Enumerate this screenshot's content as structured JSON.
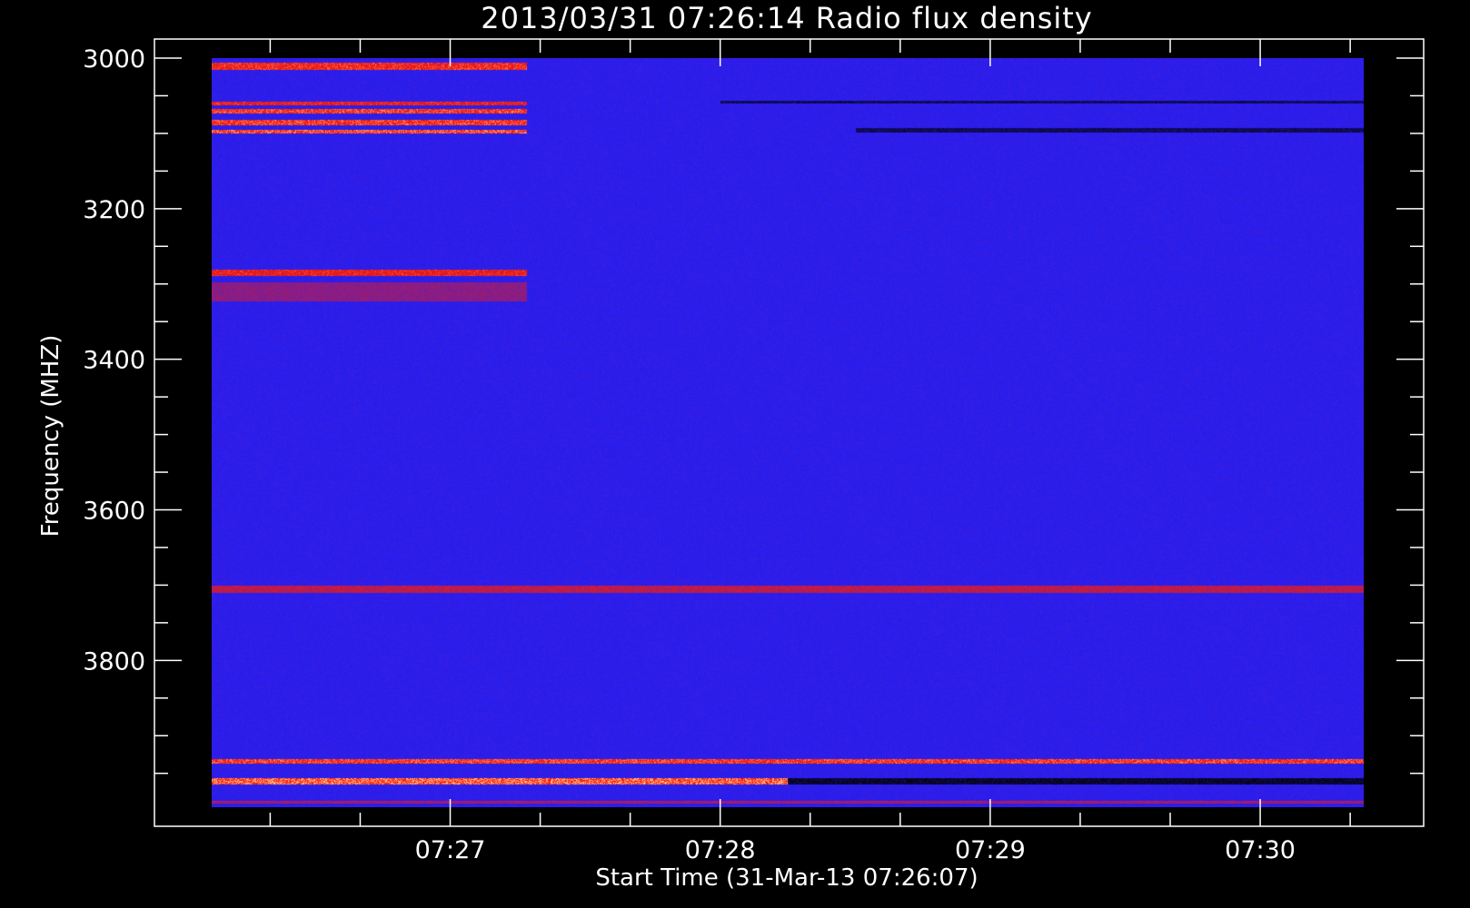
{
  "chart_data": {
    "type": "heatmap",
    "title": "2013/03/31 07:26:14 Radio flux density",
    "xlabel": "Start Time (31-Mar-13 07:26:07)",
    "ylabel": "Frequency (MHZ)",
    "x_tick_labels": [
      "07:27",
      "07:28",
      "07:29",
      "07:30"
    ],
    "y_tick_labels": [
      "3000",
      "3200",
      "3400",
      "3600",
      "3800"
    ],
    "y_ticks_mhz": [
      3000,
      3200,
      3400,
      3600,
      3800
    ],
    "y_range_mhz": [
      3000,
      3995
    ],
    "y_inverted": true,
    "x_ticks": [
      "07:27:00",
      "07:28:00",
      "07:29:00",
      "07:30:00"
    ],
    "x_minor_tick_seconds": 20,
    "y_minor_tick_mhz": 50,
    "x_range": [
      "07:26:07",
      "07:30:23"
    ],
    "colormap": [
      "#000000",
      "#1a10d8",
      "#2a1ef2",
      "#ff1a00",
      "#ffe0b0"
    ],
    "background_color": "#2a1ef2",
    "features": [
      {
        "label": "strong emission band",
        "freq_mhz": 3010,
        "width_mhz": 10,
        "start": "07:26:07",
        "end": "07:27:17",
        "intensity": 0.85
      },
      {
        "label": "strong emission band",
        "freq_mhz": 3060,
        "width_mhz": 5,
        "start": "07:26:07",
        "end": "07:27:17",
        "intensity": 0.8
      },
      {
        "label": "strong emission band",
        "freq_mhz": 3070,
        "width_mhz": 5,
        "start": "07:26:07",
        "end": "07:27:17",
        "intensity": 0.9
      },
      {
        "label": "strong emission band",
        "freq_mhz": 3085,
        "width_mhz": 8,
        "start": "07:26:07",
        "end": "07:27:17",
        "intensity": 0.9
      },
      {
        "label": "strong emission band",
        "freq_mhz": 3097,
        "width_mhz": 5,
        "start": "07:26:07",
        "end": "07:27:17",
        "intensity": 0.95
      },
      {
        "label": "emission band",
        "freq_mhz": 3285,
        "width_mhz": 8,
        "start": "07:26:07",
        "end": "07:27:17",
        "intensity": 0.8
      },
      {
        "label": "weak emission band",
        "freq_mhz": 3310,
        "width_mhz": 25,
        "start": "07:26:07",
        "end": "07:27:17",
        "intensity": 0.4
      },
      {
        "label": "interference band",
        "freq_mhz": 3705,
        "width_mhz": 10,
        "start": "07:26:07",
        "end": "07:30:23",
        "intensity": 0.6
      },
      {
        "label": "strong emission band",
        "freq_mhz": 3933,
        "width_mhz": 6,
        "start": "07:26:07",
        "end": "07:30:23",
        "intensity": 0.9
      },
      {
        "label": "strong emission band",
        "freq_mhz": 3960,
        "width_mhz": 8,
        "start": "07:26:07",
        "end": "07:28:15",
        "intensity": 1.0
      },
      {
        "label": "absorption band",
        "freq_mhz": 3960,
        "width_mhz": 8,
        "start": "07:28:15",
        "end": "07:30:23",
        "intensity": -1.0
      },
      {
        "label": "absorption band",
        "freq_mhz": 3058,
        "width_mhz": 4,
        "start": "07:28:00",
        "end": "07:30:23",
        "intensity": -0.8
      },
      {
        "label": "absorption band",
        "freq_mhz": 3095,
        "width_mhz": 6,
        "start": "07:28:30",
        "end": "07:30:23",
        "intensity": -0.8
      },
      {
        "label": "weak emission band",
        "freq_mhz": 3988,
        "width_mhz": 4,
        "start": "07:26:07",
        "end": "07:30:23",
        "intensity": 0.5
      }
    ]
  }
}
